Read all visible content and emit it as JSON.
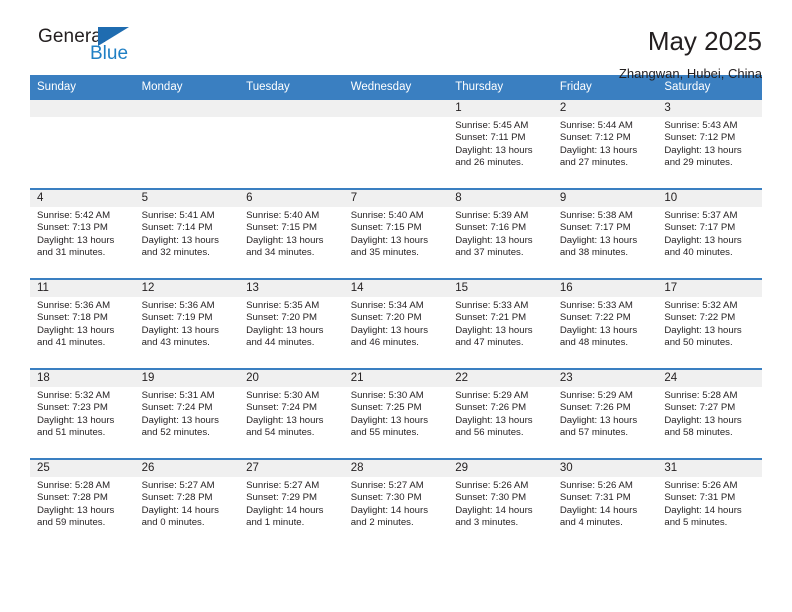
{
  "brand": {
    "name_part1": "General",
    "name_part2": "Blue",
    "flag_icon": "blue-triangle-flag-icon"
  },
  "header": {
    "title": "May 2025",
    "subtitle": "Zhangwan, Hubei, China"
  },
  "calendar": {
    "weekday_headers": [
      "Sunday",
      "Monday",
      "Tuesday",
      "Wednesday",
      "Thursday",
      "Friday",
      "Saturday"
    ],
    "accent_color": "#3a7fc1",
    "date_strip_color": "#f0f0f0",
    "labels": {
      "sunrise": "Sunrise:",
      "sunset": "Sunset:",
      "daylight": "Daylight:"
    },
    "weeks": [
      [
        {
          "empty": true
        },
        {
          "empty": true
        },
        {
          "empty": true
        },
        {
          "empty": true
        },
        {
          "day": "1",
          "sunrise": "Sunrise: 5:45 AM",
          "sunset": "Sunset: 7:11 PM",
          "daylight_line1": "Daylight: 13 hours",
          "daylight_line2": "and 26 minutes."
        },
        {
          "day": "2",
          "sunrise": "Sunrise: 5:44 AM",
          "sunset": "Sunset: 7:12 PM",
          "daylight_line1": "Daylight: 13 hours",
          "daylight_line2": "and 27 minutes."
        },
        {
          "day": "3",
          "sunrise": "Sunrise: 5:43 AM",
          "sunset": "Sunset: 7:12 PM",
          "daylight_line1": "Daylight: 13 hours",
          "daylight_line2": "and 29 minutes."
        }
      ],
      [
        {
          "day": "4",
          "sunrise": "Sunrise: 5:42 AM",
          "sunset": "Sunset: 7:13 PM",
          "daylight_line1": "Daylight: 13 hours",
          "daylight_line2": "and 31 minutes."
        },
        {
          "day": "5",
          "sunrise": "Sunrise: 5:41 AM",
          "sunset": "Sunset: 7:14 PM",
          "daylight_line1": "Daylight: 13 hours",
          "daylight_line2": "and 32 minutes."
        },
        {
          "day": "6",
          "sunrise": "Sunrise: 5:40 AM",
          "sunset": "Sunset: 7:15 PM",
          "daylight_line1": "Daylight: 13 hours",
          "daylight_line2": "and 34 minutes."
        },
        {
          "day": "7",
          "sunrise": "Sunrise: 5:40 AM",
          "sunset": "Sunset: 7:15 PM",
          "daylight_line1": "Daylight: 13 hours",
          "daylight_line2": "and 35 minutes."
        },
        {
          "day": "8",
          "sunrise": "Sunrise: 5:39 AM",
          "sunset": "Sunset: 7:16 PM",
          "daylight_line1": "Daylight: 13 hours",
          "daylight_line2": "and 37 minutes."
        },
        {
          "day": "9",
          "sunrise": "Sunrise: 5:38 AM",
          "sunset": "Sunset: 7:17 PM",
          "daylight_line1": "Daylight: 13 hours",
          "daylight_line2": "and 38 minutes."
        },
        {
          "day": "10",
          "sunrise": "Sunrise: 5:37 AM",
          "sunset": "Sunset: 7:17 PM",
          "daylight_line1": "Daylight: 13 hours",
          "daylight_line2": "and 40 minutes."
        }
      ],
      [
        {
          "day": "11",
          "sunrise": "Sunrise: 5:36 AM",
          "sunset": "Sunset: 7:18 PM",
          "daylight_line1": "Daylight: 13 hours",
          "daylight_line2": "and 41 minutes."
        },
        {
          "day": "12",
          "sunrise": "Sunrise: 5:36 AM",
          "sunset": "Sunset: 7:19 PM",
          "daylight_line1": "Daylight: 13 hours",
          "daylight_line2": "and 43 minutes."
        },
        {
          "day": "13",
          "sunrise": "Sunrise: 5:35 AM",
          "sunset": "Sunset: 7:20 PM",
          "daylight_line1": "Daylight: 13 hours",
          "daylight_line2": "and 44 minutes."
        },
        {
          "day": "14",
          "sunrise": "Sunrise: 5:34 AM",
          "sunset": "Sunset: 7:20 PM",
          "daylight_line1": "Daylight: 13 hours",
          "daylight_line2": "and 46 minutes."
        },
        {
          "day": "15",
          "sunrise": "Sunrise: 5:33 AM",
          "sunset": "Sunset: 7:21 PM",
          "daylight_line1": "Daylight: 13 hours",
          "daylight_line2": "and 47 minutes."
        },
        {
          "day": "16",
          "sunrise": "Sunrise: 5:33 AM",
          "sunset": "Sunset: 7:22 PM",
          "daylight_line1": "Daylight: 13 hours",
          "daylight_line2": "and 48 minutes."
        },
        {
          "day": "17",
          "sunrise": "Sunrise: 5:32 AM",
          "sunset": "Sunset: 7:22 PM",
          "daylight_line1": "Daylight: 13 hours",
          "daylight_line2": "and 50 minutes."
        }
      ],
      [
        {
          "day": "18",
          "sunrise": "Sunrise: 5:32 AM",
          "sunset": "Sunset: 7:23 PM",
          "daylight_line1": "Daylight: 13 hours",
          "daylight_line2": "and 51 minutes."
        },
        {
          "day": "19",
          "sunrise": "Sunrise: 5:31 AM",
          "sunset": "Sunset: 7:24 PM",
          "daylight_line1": "Daylight: 13 hours",
          "daylight_line2": "and 52 minutes."
        },
        {
          "day": "20",
          "sunrise": "Sunrise: 5:30 AM",
          "sunset": "Sunset: 7:24 PM",
          "daylight_line1": "Daylight: 13 hours",
          "daylight_line2": "and 54 minutes."
        },
        {
          "day": "21",
          "sunrise": "Sunrise: 5:30 AM",
          "sunset": "Sunset: 7:25 PM",
          "daylight_line1": "Daylight: 13 hours",
          "daylight_line2": "and 55 minutes."
        },
        {
          "day": "22",
          "sunrise": "Sunrise: 5:29 AM",
          "sunset": "Sunset: 7:26 PM",
          "daylight_line1": "Daylight: 13 hours",
          "daylight_line2": "and 56 minutes."
        },
        {
          "day": "23",
          "sunrise": "Sunrise: 5:29 AM",
          "sunset": "Sunset: 7:26 PM",
          "daylight_line1": "Daylight: 13 hours",
          "daylight_line2": "and 57 minutes."
        },
        {
          "day": "24",
          "sunrise": "Sunrise: 5:28 AM",
          "sunset": "Sunset: 7:27 PM",
          "daylight_line1": "Daylight: 13 hours",
          "daylight_line2": "and 58 minutes."
        }
      ],
      [
        {
          "day": "25",
          "sunrise": "Sunrise: 5:28 AM",
          "sunset": "Sunset: 7:28 PM",
          "daylight_line1": "Daylight: 13 hours",
          "daylight_line2": "and 59 minutes."
        },
        {
          "day": "26",
          "sunrise": "Sunrise: 5:27 AM",
          "sunset": "Sunset: 7:28 PM",
          "daylight_line1": "Daylight: 14 hours",
          "daylight_line2": "and 0 minutes."
        },
        {
          "day": "27",
          "sunrise": "Sunrise: 5:27 AM",
          "sunset": "Sunset: 7:29 PM",
          "daylight_line1": "Daylight: 14 hours",
          "daylight_line2": "and 1 minute."
        },
        {
          "day": "28",
          "sunrise": "Sunrise: 5:27 AM",
          "sunset": "Sunset: 7:30 PM",
          "daylight_line1": "Daylight: 14 hours",
          "daylight_line2": "and 2 minutes."
        },
        {
          "day": "29",
          "sunrise": "Sunrise: 5:26 AM",
          "sunset": "Sunset: 7:30 PM",
          "daylight_line1": "Daylight: 14 hours",
          "daylight_line2": "and 3 minutes."
        },
        {
          "day": "30",
          "sunrise": "Sunrise: 5:26 AM",
          "sunset": "Sunset: 7:31 PM",
          "daylight_line1": "Daylight: 14 hours",
          "daylight_line2": "and 4 minutes."
        },
        {
          "day": "31",
          "sunrise": "Sunrise: 5:26 AM",
          "sunset": "Sunset: 7:31 PM",
          "daylight_line1": "Daylight: 14 hours",
          "daylight_line2": "and 5 minutes."
        }
      ]
    ]
  }
}
